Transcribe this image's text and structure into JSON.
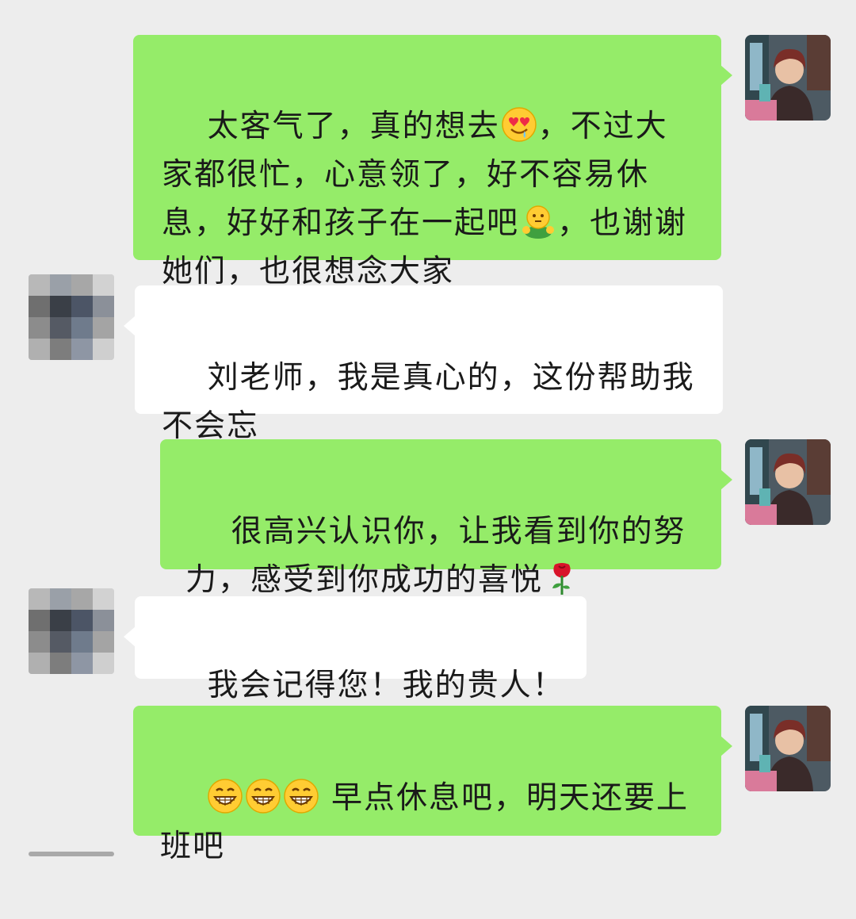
{
  "messages": [
    {
      "side": "outgoing",
      "segments": [
        {
          "text": "太客气了，真的想去"
        },
        {
          "emoji": "heart-eyes-drool-emoji"
        },
        {
          "text": "，不过大家都很忙，心意领了，好不容易休息，好好和孩子在一起吧"
        },
        {
          "emoji": "hug-emoji"
        },
        {
          "text": "，也谢谢她们，也很想念大家"
        }
      ]
    },
    {
      "side": "incoming",
      "segments": [
        {
          "text": "刘老师，我是真心的，这份帮助我不会忘"
        }
      ]
    },
    {
      "side": "outgoing",
      "segments": [
        {
          "text": "很高兴认识你，让我看到你的努力，感受到你成功的喜悦"
        },
        {
          "emoji": "rose-emoji"
        }
      ]
    },
    {
      "side": "incoming",
      "segments": [
        {
          "text": "我会记得您！我的贵人！"
        }
      ]
    },
    {
      "side": "outgoing",
      "segments": [
        {
          "emoji": "grin-emoji"
        },
        {
          "emoji": "grin-emoji"
        },
        {
          "emoji": "grin-emoji"
        },
        {
          "text": " 早点休息吧，明天还要上班吧"
        }
      ]
    }
  ],
  "colors": {
    "background": "#ededed",
    "outgoing_bubble": "#95ec69",
    "incoming_bubble": "#ffffff",
    "text": "#1a1a1a"
  }
}
